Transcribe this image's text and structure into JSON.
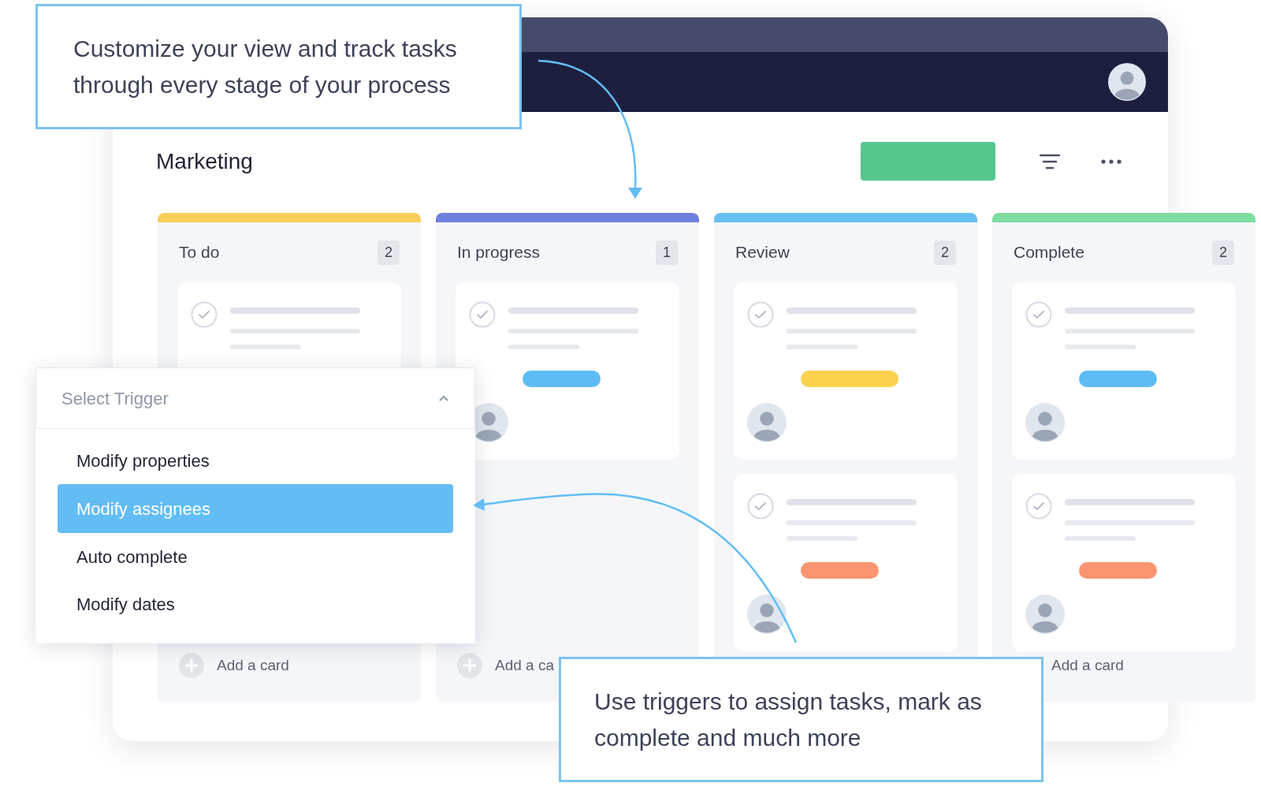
{
  "callouts": [
    {
      "text": "Customize your view and track tasks through every stage of your process"
    },
    {
      "text": "Use triggers to assign tasks, mark as complete and much more"
    }
  ],
  "board": {
    "title": "Marketing",
    "columns": [
      {
        "name": "To do",
        "count": "2",
        "color": "#f9cf5a",
        "cards": [
          {
            "avatar": false
          }
        ],
        "add_icon": true,
        "add_label": "Add a card"
      },
      {
        "name": "In progress",
        "count": "1",
        "color": "#6f7fe0",
        "cards": [
          {
            "color": "#5dbcf4",
            "avatar": true
          }
        ],
        "add_icon": true,
        "add_label": "Add a ca"
      },
      {
        "name": "Review",
        "count": "2",
        "color": "#67c0f3",
        "cards": [
          {
            "color": "#fbd24e",
            "avatar": true
          },
          {
            "color": "#fb9470",
            "avatar": true
          }
        ]
      },
      {
        "name": "Complete",
        "count": "2",
        "color": "#7ddc9f",
        "cards": [
          {
            "color": "#5dbcf4",
            "avatar": true
          },
          {
            "color": "#fb9470",
            "avatar": true
          }
        ],
        "add_icon": false,
        "add_label": "Add a card"
      }
    ]
  },
  "trigger_menu": {
    "placeholder": "Select Trigger",
    "expanded": true,
    "options": [
      {
        "label": "Modify properties",
        "selected": false
      },
      {
        "label": "Modify assignees",
        "selected": true
      },
      {
        "label": "Auto complete",
        "selected": false
      },
      {
        "label": "Modify dates",
        "selected": false
      }
    ]
  }
}
